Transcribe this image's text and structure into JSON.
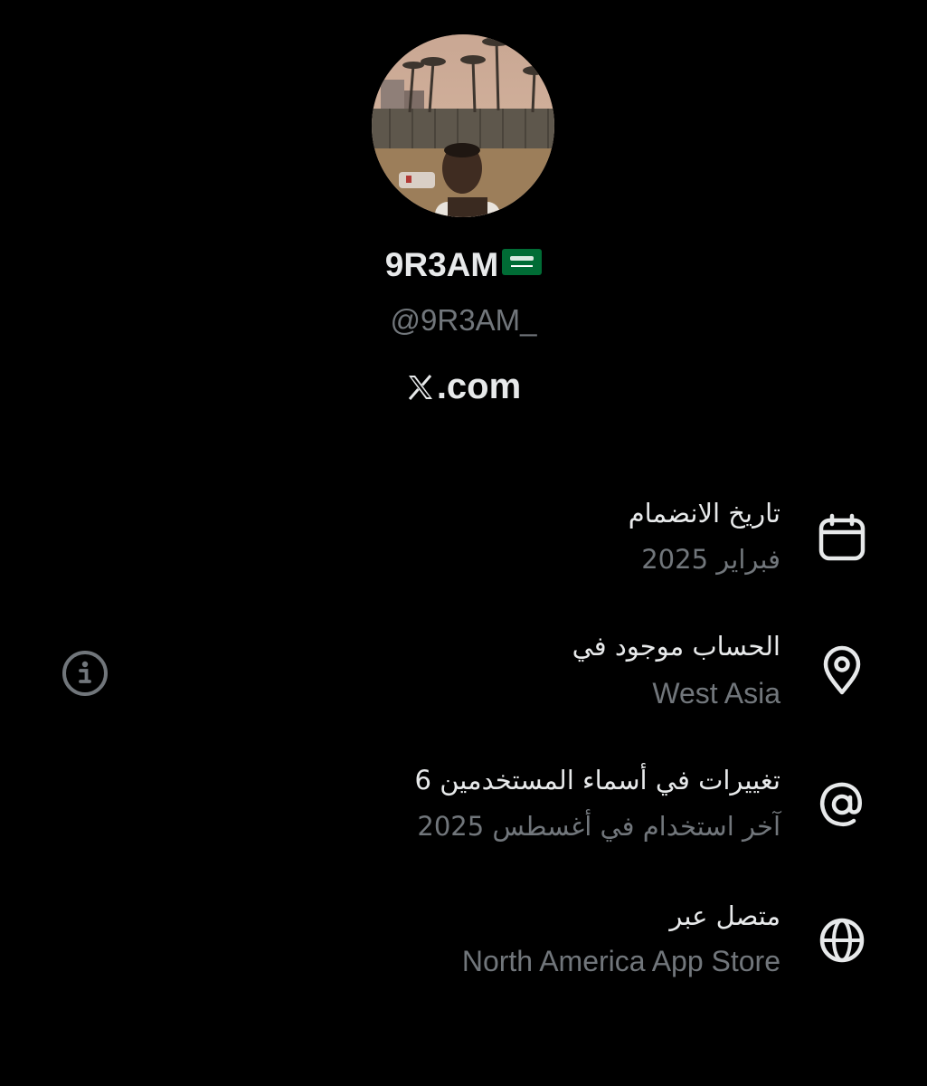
{
  "profile": {
    "display_name": "9R3AM",
    "flag_icon": "saudi-arabia-flag-icon",
    "handle": "@9R3AM_",
    "brand": ".com",
    "brand_icon": "x-logo-icon"
  },
  "about": {
    "joined": {
      "label": "تاريخ الانضمام",
      "value": "فبراير 2025",
      "icon": "calendar-icon"
    },
    "location": {
      "label": "الحساب موجود في",
      "value": "West Asia",
      "icon": "location-pin-icon",
      "info_icon": "info-icon"
    },
    "username_changes": {
      "label": "6 تغييرات في أسماء المستخدمين",
      "value": "آخر استخدام في أغسطس 2025",
      "icon": "at-sign-icon"
    },
    "connected_via": {
      "label": "متصل عبر",
      "value": "North America App Store",
      "icon": "globe-icon"
    }
  },
  "colors": {
    "background": "#000000",
    "primary_text": "#e7e9ea",
    "secondary_text": "#71767b",
    "flag_green": "#006c35"
  }
}
